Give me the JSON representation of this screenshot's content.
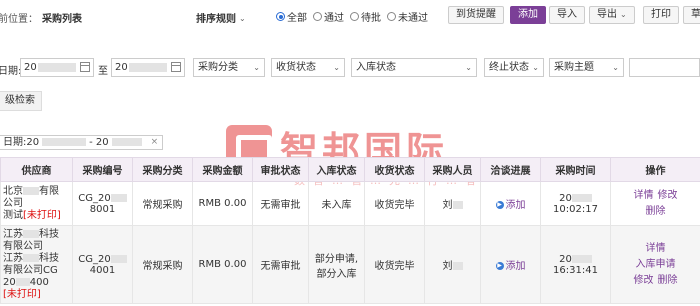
{
  "breadcrumb": {
    "label": "前位置：",
    "page": "采购列表"
  },
  "toolbar": {
    "sort": "排序规则",
    "filters": [
      {
        "label": "全部",
        "checked": true
      },
      {
        "label": "通过",
        "checked": false
      },
      {
        "label": "待批",
        "checked": false
      },
      {
        "label": "未通过",
        "checked": false
      }
    ],
    "buttons": {
      "arrival_reminder": "到货提醒",
      "add": "添加",
      "import": "导入",
      "export": "导出",
      "print": "打印",
      "more": "草"
    }
  },
  "search": {
    "date_label": "日期:",
    "date_from": "20",
    "to_label": "至",
    "date_to": "20",
    "category": "采购分类",
    "receive_status": "收货状态",
    "stock_status": "入库状态",
    "stop_status": "终止状态",
    "subject": "采购主题",
    "advanced": "级检索"
  },
  "active_filter": {
    "text_prefix": "日期:20",
    "text_mid": "- 20",
    "close": "×"
  },
  "table": {
    "headers": [
      "供应商",
      "采购编号",
      "采购分类",
      "采购金额",
      "审批状态",
      "入库状态",
      "收货状态",
      "采购人员",
      "洽谈进展",
      "采购时间",
      "操作"
    ],
    "rows": [
      {
        "supplier_a": "北京",
        "supplier_b": "有限",
        "supplier_c": "公司",
        "supplier_d": "测试",
        "supplier_flag": "[未打印]",
        "code_a": "CG_20",
        "code_b": "8001",
        "category": "常规采购",
        "amount": "RMB 0.00",
        "approval": "无需审批",
        "stock": "未入库",
        "receive": "收货完毕",
        "person": "刘",
        "progress": "添加",
        "time_a": "20",
        "time_b": "10:02:17",
        "ops": [
          "详情",
          "修改",
          "删除"
        ]
      },
      {
        "supplier_a": "江苏",
        "supplier_b": "科技",
        "supplier_c": "有限公司",
        "supplier_d": "江苏",
        "supplier_e": "科技",
        "supplier_f": "有限公司CG",
        "supplier_g": "20",
        "supplier_h": "400",
        "supplier_flag": "[未打印]",
        "code_a": "CG_20",
        "code_b": "4001",
        "category": "常规采购",
        "amount": "RMB 0.00",
        "approval": "无需审批",
        "stock_a": "部分申请,",
        "stock_b": "部分入库",
        "receive": "收货完毕",
        "person": "刘",
        "progress": "添加",
        "time_a": "20",
        "time_b": "16:31:41",
        "ops": [
          "详情",
          "入库申请",
          "修改",
          "删除"
        ]
      }
    ]
  },
  "watermark": {
    "brand": "智邦国际",
    "slogan": "数智…管…先…行…者"
  },
  "colors": {
    "accent": "#7b3f97",
    "radio": "#2a6cd4",
    "header_bg": "#f4eef6",
    "flag": "#dd1111",
    "watermark": "#e23d3d"
  }
}
